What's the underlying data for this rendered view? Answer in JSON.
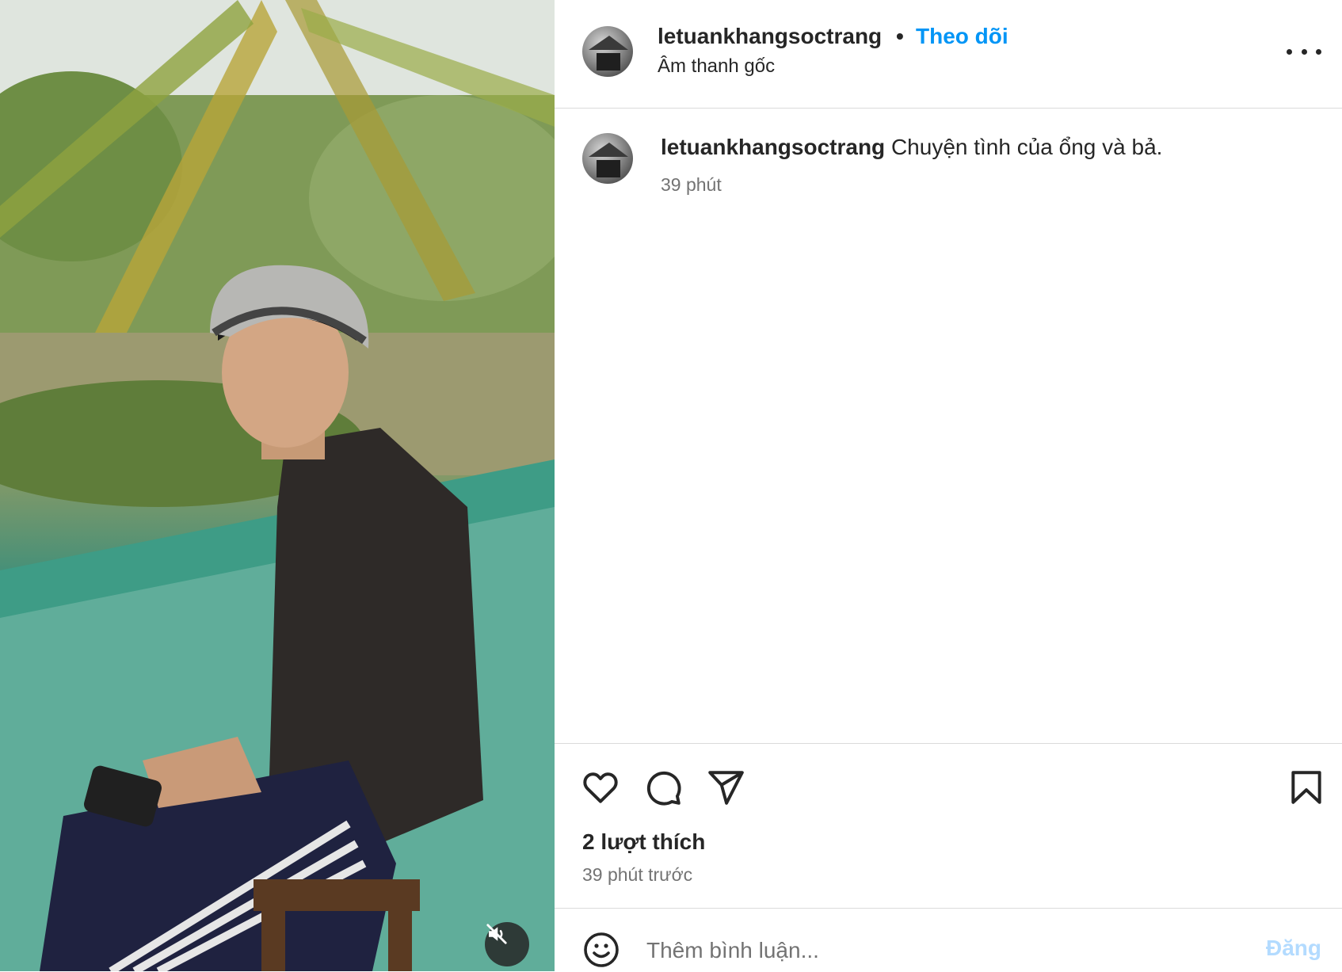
{
  "post": {
    "username": "letuankhangsoctrang",
    "follow_label": "Theo dõi",
    "separator": "•",
    "audio_label": "Âm thanh gốc"
  },
  "caption": {
    "username": "letuankhangsoctrang",
    "text": "Chuyện tình của ổng và bả.",
    "time": "39 phút"
  },
  "engagement": {
    "likes": "2 lượt thích",
    "posted_ago": "39 phút trước"
  },
  "comment": {
    "placeholder": "Thêm bình luận...",
    "post_label": "Đăng"
  },
  "icons": {
    "more": "more-options-icon",
    "like": "heart-icon",
    "comment": "comment-bubble-icon",
    "share": "paper-plane-icon",
    "save": "bookmark-icon",
    "emoji": "emoji-smile-icon",
    "mute": "speaker-muted-icon"
  },
  "colors": {
    "accent": "#0095f6",
    "disabled_accent": "#b3dbff",
    "secondary_text": "#737373",
    "divider": "#dbdbdb"
  }
}
